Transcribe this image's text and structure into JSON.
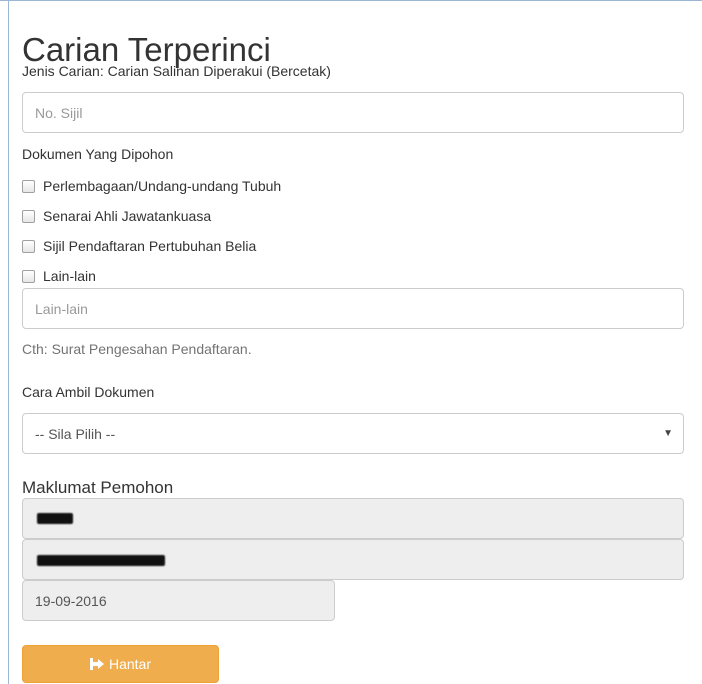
{
  "page": {
    "title": "Carian Terperinci",
    "search_type": "Jenis Carian: Carian Salinan Diperakui (Bercetak)"
  },
  "certificate": {
    "placeholder": "No. Sijil",
    "value": ""
  },
  "documents": {
    "label": "Dokumen Yang Dipohon",
    "options": [
      {
        "label": "Perlembagaan/Undang-undang Tubuh",
        "checked": false
      },
      {
        "label": "Senarai Ahli Jawatankuasa",
        "checked": false
      },
      {
        "label": "Sijil Pendaftaran Pertubuhan Belia",
        "checked": false
      },
      {
        "label": "Lain-lain",
        "checked": false
      }
    ],
    "other_placeholder": "Lain-lain",
    "other_help": "Cth: Surat Pengesahan Pendaftaran."
  },
  "collection": {
    "label": "Cara Ambil Dokumen",
    "selected": "-- Sila Pilih --",
    "arrow_icon": "caret-down-icon"
  },
  "applicant": {
    "heading": "Maklumat Pemohon",
    "name_redacted": true,
    "ic_redacted": true,
    "date": "19-09-2016"
  },
  "submit": {
    "label": "Hantar",
    "icon": "share-arrow-icon",
    "color": "#f0ad4e"
  }
}
